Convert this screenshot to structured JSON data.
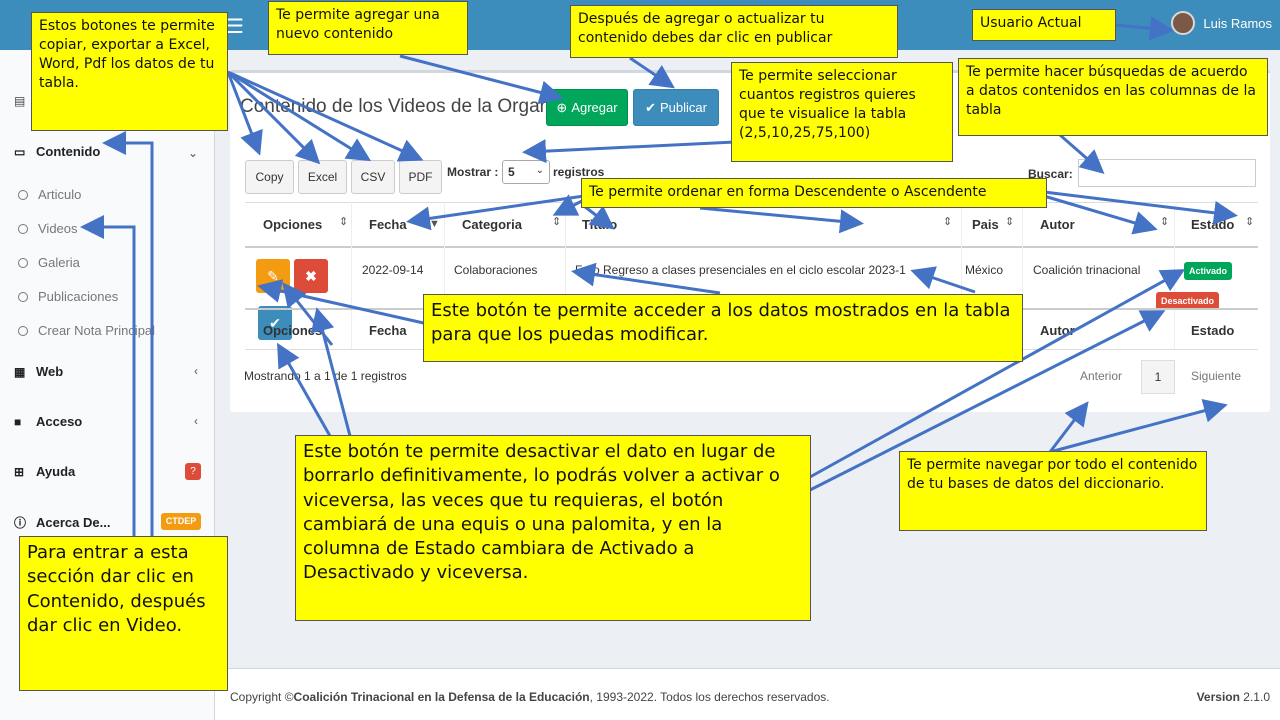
{
  "header": {
    "user_name": "Luis Ramos"
  },
  "sidebar": {
    "contenido": "Contenido",
    "subitems": [
      "Articulo",
      "Videos",
      "Galeria",
      "Publicaciones",
      "Crear Nota Principal"
    ],
    "web": "Web",
    "acceso": "Acceso",
    "ayuda": "Ayuda",
    "ayuda_badge": "?",
    "acerca": "Acerca De...",
    "acerca_badge": "CTDEP"
  },
  "main": {
    "title": "Contenido de los Videos de la Organizaciòn",
    "add_label": "Agregar",
    "publish_label": "Publicar",
    "export_buttons": [
      "Copy",
      "Excel",
      "CSV",
      "PDF"
    ],
    "show_label": "Mostrar :",
    "show_value": "5",
    "records_label": "registros",
    "search_label": "Buscar:",
    "columns": [
      "Opciones",
      "Fecha",
      "Categoria",
      "Titulo",
      "Pais",
      "Autor",
      "Estado"
    ],
    "row": {
      "fecha": "2022-09-14",
      "categoria": "Colaboraciones",
      "titulo": "Foro Regreso a clases presenciales en el ciclo escolar 2023-1",
      "pais": "México",
      "autor": "Coalición trinacional",
      "estado_activo": "Activado",
      "estado_inactivo": "Desactivado"
    },
    "info": "Mostrando 1 a 1 de 1 registros",
    "prev": "Anterior",
    "page": "1",
    "next": "Siguiente"
  },
  "footer": {
    "copyright_prefix": "Copyright ©",
    "org": "Coalición Trinacional en la Defensa de la Educación",
    "copyright_suffix": ", 1993-2022. Todos los derechos reservados.",
    "version_label": "Version",
    "version_value": "2.1.0"
  },
  "notes": {
    "export": "Estos botones te permite copiar, exportar a Excel, Word, Pdf los datos de tu tabla.",
    "add": "Te permite agregar una nuevo contenido",
    "publish": "Después de agregar o actualizar tu contenido debes dar clic en publicar",
    "user": "Usuario Actual",
    "select": "Te permite seleccionar cuantos registros quieres que te visualice la tabla (2,5,10,25,75,100)",
    "search": "Te permite hacer búsquedas de acuerdo a datos contenidos en las columnas de la tabla",
    "sort": "Te permite ordenar en forma Descendente o Ascendente",
    "edit": "Este botón te permite acceder a los datos mostrados en la tabla para que los puedas modificar.",
    "toggle": "Este botón te permite desactivar el dato en lugar de borrarlo definitivamente, lo podrás volver a activar o viceversa, las veces que tu requieras, el botón cambiará de una equis o una palomita, y en la columna de Estado cambiara de Activado a Desactivado y viceversa.",
    "nav": "Te permite navegar por todo el contenido de tu bases de datos del diccionario.",
    "enter": "Para entrar a esta sección dar clic en Contenido, después dar clic en Video."
  },
  "colors": {
    "header": "#3c8dbc",
    "note_bg": "#ffff00",
    "arrow": "#4472c4",
    "success": "#00a65a",
    "danger": "#dd4b39",
    "warning": "#f39c12"
  }
}
